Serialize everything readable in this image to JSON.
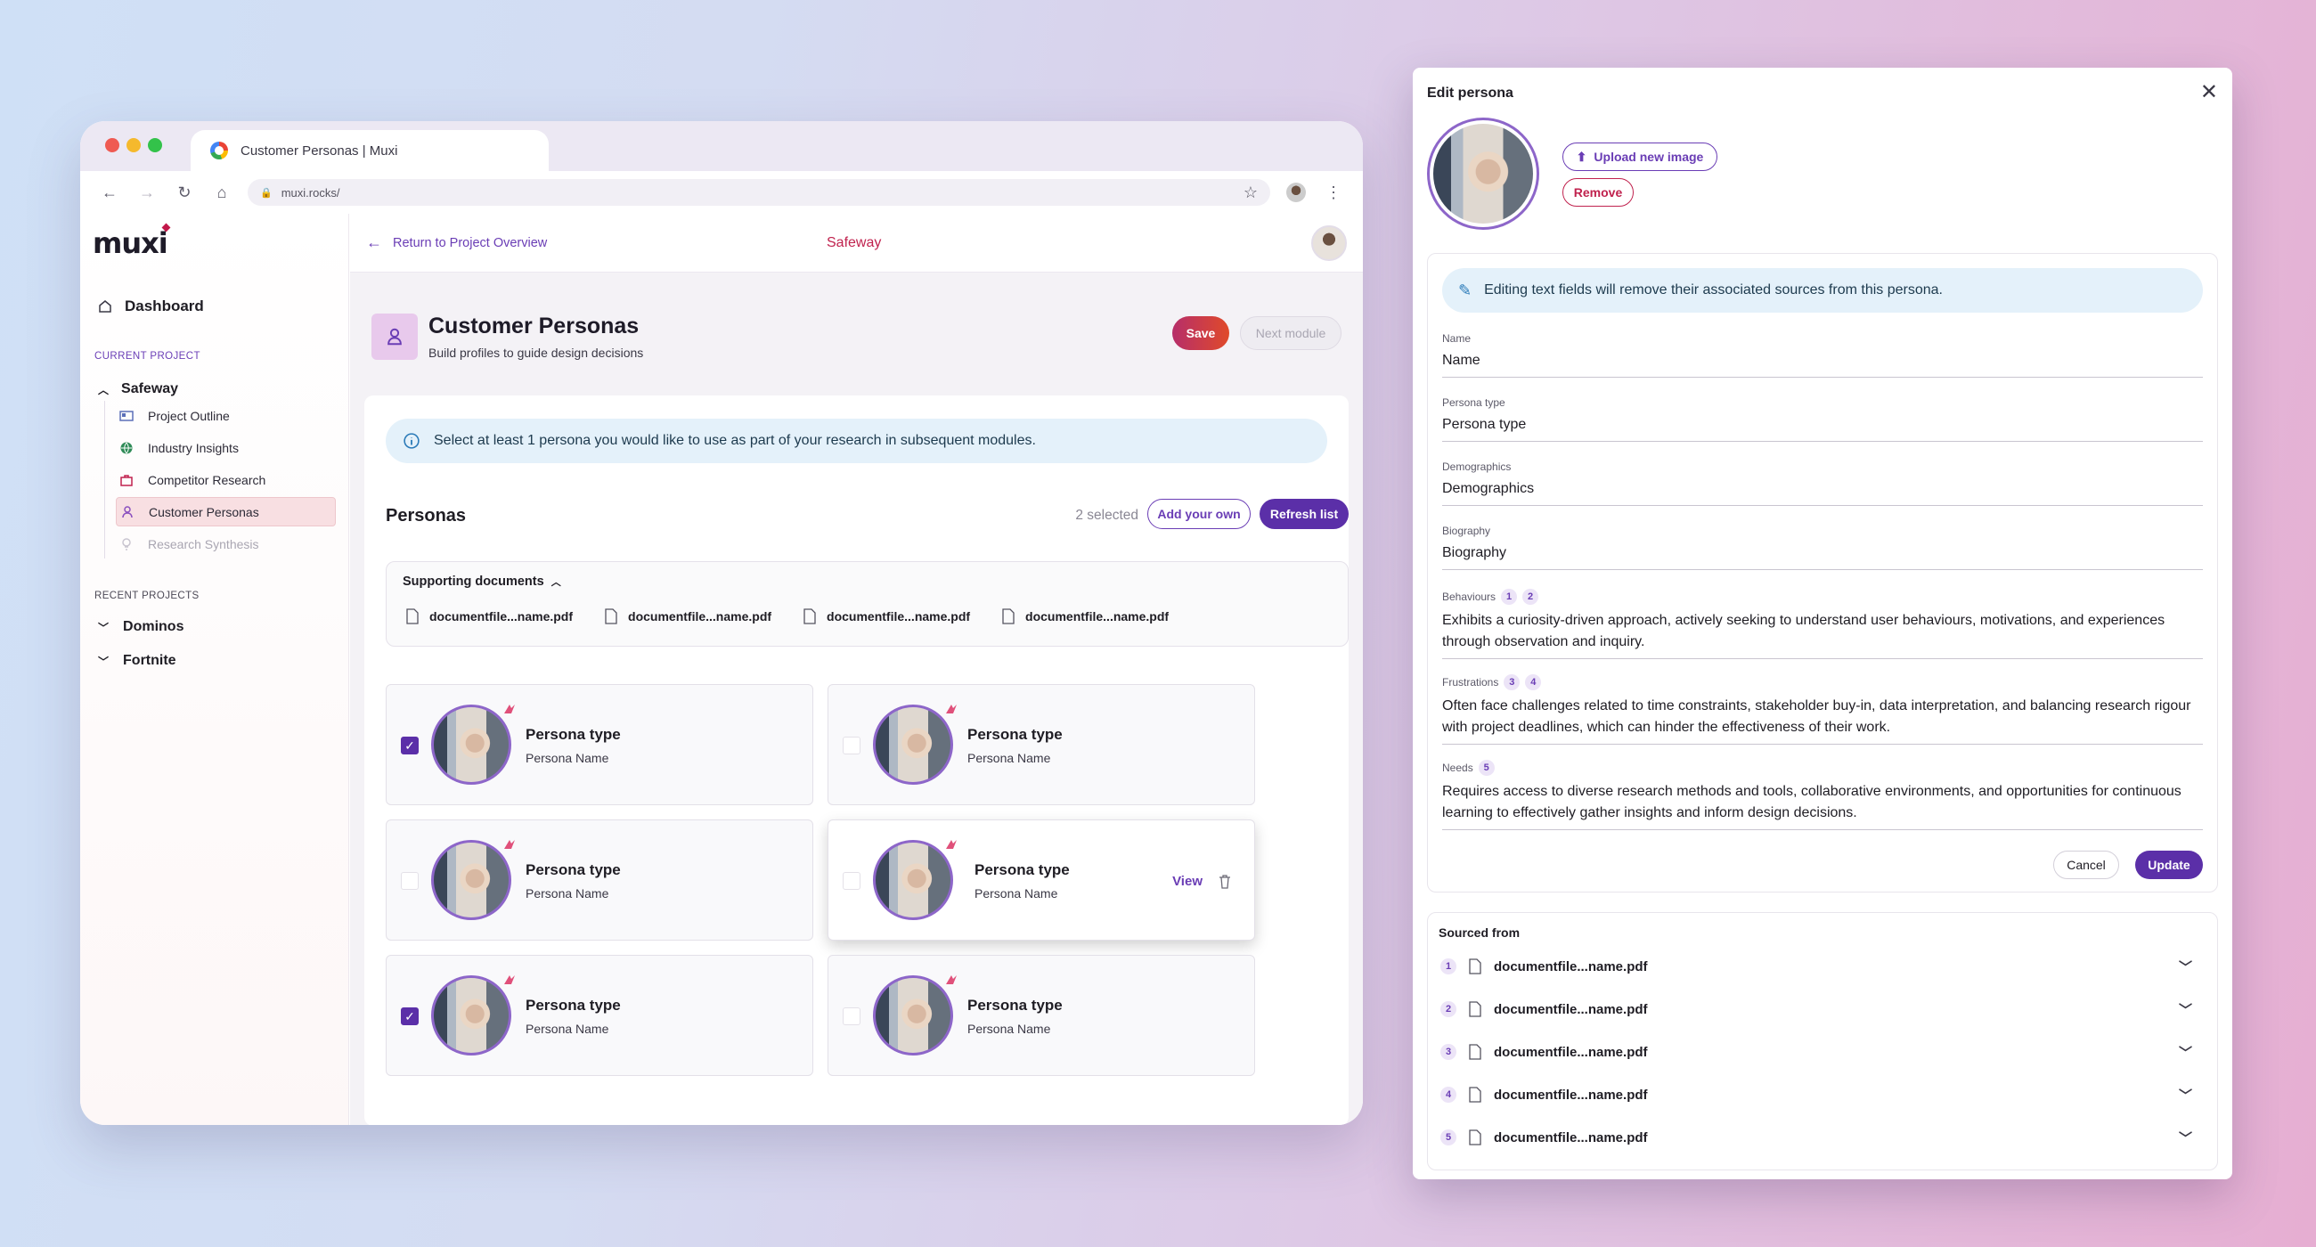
{
  "browser": {
    "tab_title": "Customer Personas | Muxi",
    "url": "muxi.rocks/"
  },
  "app": {
    "logo": "muxi"
  },
  "sidebar": {
    "dashboard": "Dashboard",
    "current_label": "CURRENT PROJECT",
    "project": "Safeway",
    "items": [
      {
        "label": "Project Outline"
      },
      {
        "label": "Industry Insights"
      },
      {
        "label": "Competitor Research"
      },
      {
        "label": "Customer Personas"
      },
      {
        "label": "Research Synthesis"
      }
    ],
    "recent_label": "RECENT PROJECTS",
    "recent": [
      {
        "label": "Dominos"
      },
      {
        "label": "Fortnite"
      }
    ]
  },
  "topbar": {
    "back": "Return to Project Overview",
    "project": "Safeway"
  },
  "page": {
    "title": "Customer Personas",
    "subtitle": "Build profiles to guide design decisions",
    "save": "Save",
    "next": "Next module"
  },
  "notice": "Select at least 1 persona you would like to use as part of your research in subsequent modules.",
  "personas": {
    "title": "Personas",
    "selected": "2 selected",
    "add": "Add your own",
    "refresh": "Refresh list",
    "docs_title": "Supporting documents",
    "docs": [
      "documentfile...name.pdf",
      "documentfile...name.pdf",
      "documentfile...name.pdf",
      "documentfile...name.pdf"
    ],
    "cards": [
      {
        "type": "Persona type",
        "name": "Persona Name",
        "checked": true
      },
      {
        "type": "Persona type",
        "name": "Persona Name",
        "checked": false
      },
      {
        "type": "Persona type",
        "name": "Persona Name",
        "checked": false
      },
      {
        "type": "Persona type",
        "name": "Persona Name",
        "checked": false,
        "view": "View"
      },
      {
        "type": "Persona type",
        "name": "Persona Name",
        "checked": true
      },
      {
        "type": "Persona type",
        "name": "Persona Name",
        "checked": false
      }
    ]
  },
  "modal": {
    "title": "Edit persona",
    "upload": "Upload new image",
    "remove": "Remove",
    "warning": "Editing text fields will remove their associated sources from this persona.",
    "fields": {
      "name": {
        "label": "Name",
        "value": "Name"
      },
      "type": {
        "label": "Persona type",
        "value": "Persona type"
      },
      "demo": {
        "label": "Demographics",
        "value": "Demographics"
      },
      "bio": {
        "label": "Biography",
        "value": "Biography"
      },
      "behav": {
        "label": "Behaviours",
        "refs": [
          "1",
          "2"
        ],
        "value": "Exhibits a curiosity-driven approach, actively seeking to understand user behaviours, motivations, and experiences through observation and inquiry."
      },
      "frust": {
        "label": "Frustrations",
        "refs": [
          "3",
          "4"
        ],
        "value": "Often face challenges related to time constraints, stakeholder buy-in, data interpretation, and balancing research rigour with project deadlines, which can hinder the effectiveness of their work."
      },
      "needs": {
        "label": "Needs",
        "refs": [
          "5"
        ],
        "value": "Requires access to diverse research methods and tools, collaborative environments, and opportunities for continuous learning to effectively gather insights and inform design decisions."
      }
    },
    "cancel": "Cancel",
    "update": "Update",
    "sourced_title": "Sourced from",
    "sources": [
      {
        "n": "1",
        "file": "documentfile...name.pdf"
      },
      {
        "n": "2",
        "file": "documentfile...name.pdf"
      },
      {
        "n": "3",
        "file": "documentfile...name.pdf"
      },
      {
        "n": "4",
        "file": "documentfile...name.pdf"
      },
      {
        "n": "5",
        "file": "documentfile...name.pdf"
      }
    ]
  },
  "colors": {
    "accent": "#5b2fa8",
    "project": "#c0224e",
    "info_bg": "#e4f1fa"
  }
}
